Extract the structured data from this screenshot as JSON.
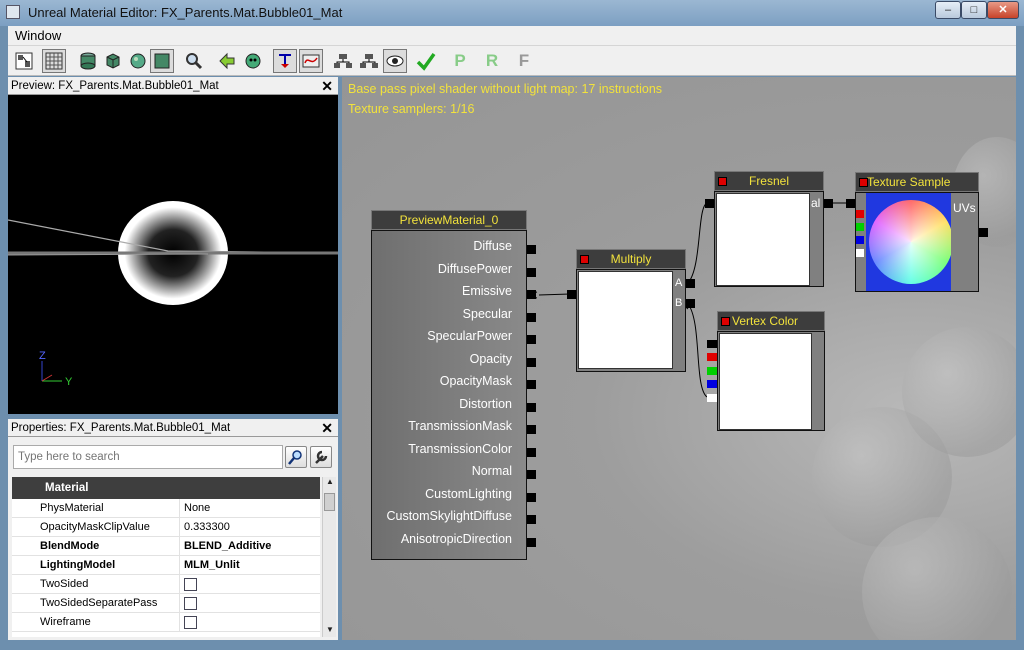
{
  "window": {
    "title": "Unreal Material Editor: FX_Parents.Mat.Bubble01_Mat",
    "minimize": "–",
    "maximize": "□",
    "close": "✕"
  },
  "menu": {
    "items": [
      "Window"
    ]
  },
  "toolbar": {
    "icons": [
      "show-connectors-icon",
      "grid-icon",
      "cylinder-preview-icon",
      "cube-preview-icon",
      "sphere-preview-icon",
      "plane-preview-icon",
      "find-icon",
      "go-back-icon",
      "preview-mesh-icon",
      "toggle-stats-icon",
      "curves-icon",
      "expression-preview-icon",
      "realtime-preview-icon",
      "hide-unused-icon",
      "apply-icon",
      "propagate-p-icon",
      "reset-r-icon",
      "fit-f-icon"
    ],
    "letters": {
      "p": "P",
      "r": "R",
      "f": "F"
    }
  },
  "preview": {
    "header": "Preview: FX_Parents.Mat.Bubble01_Mat",
    "close": "✕",
    "axis_z": "Z",
    "axis_y": "Y"
  },
  "properties": {
    "header": "Properties: FX_Parents.Mat.Bubble01_Mat",
    "close": "✕",
    "search_placeholder": "Type here to search",
    "category": "Material",
    "rows": [
      {
        "name": "PhysMaterial",
        "value": "None",
        "bold": false
      },
      {
        "name": "OpacityMaskClipValue",
        "value": "0.333300",
        "bold": false
      },
      {
        "name": "BlendMode",
        "value": "BLEND_Additive",
        "bold": true
      },
      {
        "name": "LightingModel",
        "value": "MLM_Unlit",
        "bold": true
      },
      {
        "name": "TwoSided",
        "checkbox": false
      },
      {
        "name": "TwoSidedSeparatePass",
        "checkbox": false
      },
      {
        "name": "Wireframe",
        "checkbox": false
      }
    ]
  },
  "canvas": {
    "stats": [
      "Base pass pixel shader without light map: 17 instructions",
      "Texture samplers: 1/16"
    ],
    "material_node": {
      "title": "PreviewMaterial_0",
      "inputs": [
        "Diffuse",
        "DiffusePower",
        "Emissive",
        "Specular",
        "SpecularPower",
        "Opacity",
        "OpacityMask",
        "Distortion",
        "TransmissionMask",
        "TransmissionColor",
        "Normal",
        "CustomLighting",
        "CustomSkylightDiffuse",
        "AnisotropicDirection"
      ]
    },
    "multiply_node": {
      "title": "Multiply",
      "pin_a": "A",
      "pin_b": "B"
    },
    "fresnel_node": {
      "title": "Fresnel",
      "pin_label": "al"
    },
    "texture_node": {
      "title": "Texture Sample",
      "pin_uvs": "UVs"
    },
    "vertex_node": {
      "title": "Vertex Color"
    },
    "channel_colors": [
      "#000000",
      "#e00000",
      "#00d000",
      "#0000e0",
      "#ffffff"
    ]
  }
}
